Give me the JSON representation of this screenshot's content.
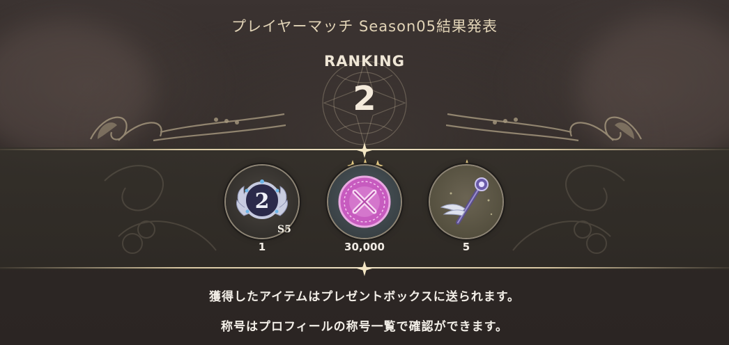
{
  "header": {
    "title": "プレイヤーマッチ Season05結果発表",
    "ranking_label": "RANKING",
    "ranking_value": "2"
  },
  "rewards": [
    {
      "icon": "rank-medal-icon",
      "badge": "S5",
      "count": "1",
      "rarity_stars": 0
    },
    {
      "icon": "pink-coin-icon",
      "count": "30,000",
      "rarity_stars": 3
    },
    {
      "icon": "winged-wand-icon",
      "count": "5",
      "rarity_stars": 1
    }
  ],
  "messages": {
    "line1": "獲得したアイテムはプレゼントボックスに送られます。",
    "line2": "称号はプロフィールの称号一覧で確認ができます。"
  },
  "colors": {
    "gold_accent": "#e2d4b7",
    "band_line": "#d8c7a2",
    "coin_pink": "#c75bbf",
    "medal_navy": "#2b2a4a"
  }
}
